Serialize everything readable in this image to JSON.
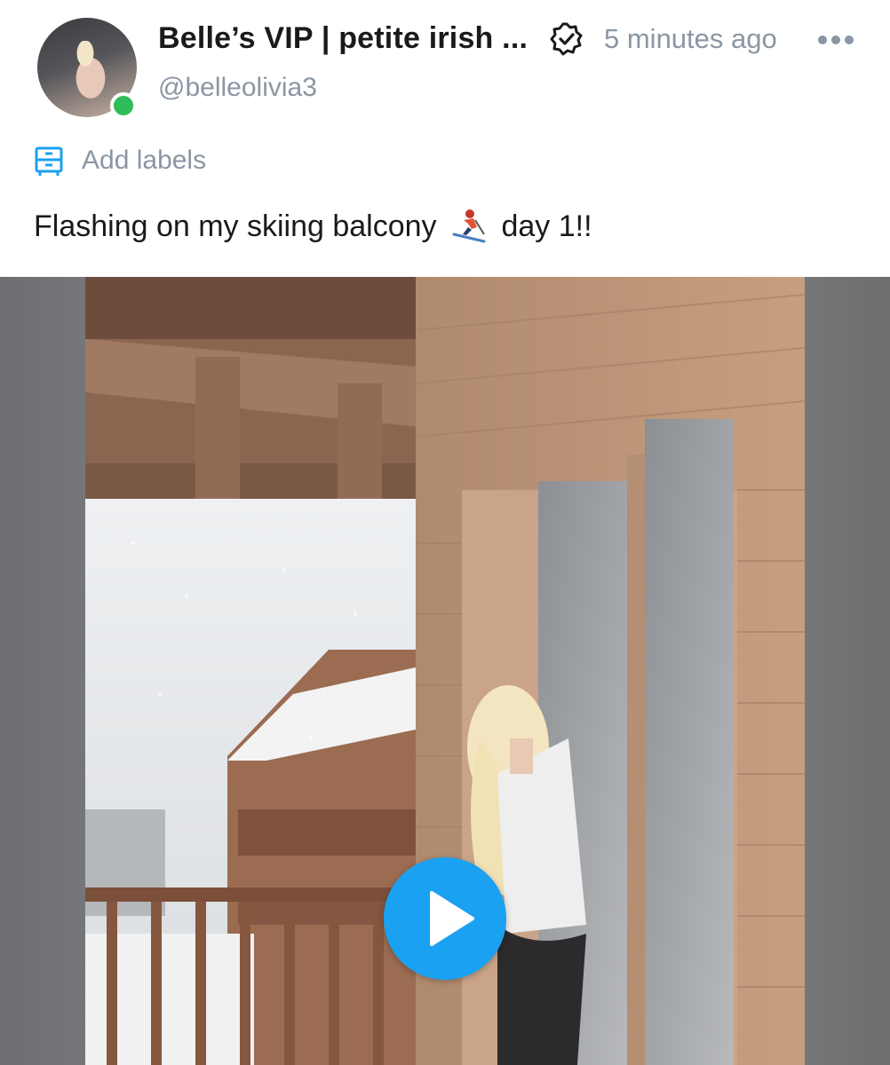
{
  "post": {
    "author_name": "Belle’s VIP | petite irish ...",
    "handle": "@belleolivia3",
    "timestamp": "5 minutes ago",
    "add_labels": "Add labels",
    "caption_before": "Flashing on my skiing balcony",
    "caption_after": "day 1!!"
  },
  "icons": {
    "verified": "verified-badge-icon",
    "more": "more-options-icon",
    "labels": "label-tag-icon",
    "emoji": "skier-emoji-icon",
    "play": "play-icon"
  },
  "colors": {
    "accent": "#1ba1f1",
    "muted": "#8a96a3",
    "online": "#2ebd59",
    "text": "#1a1a1a"
  }
}
